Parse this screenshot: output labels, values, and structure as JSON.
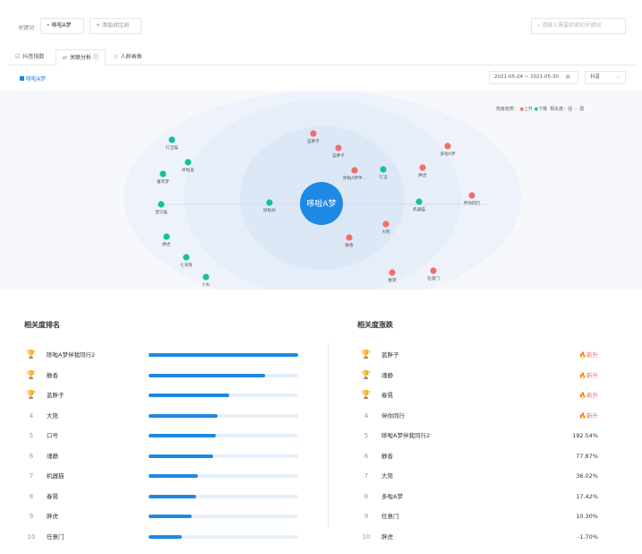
{
  "keyword_bar": {
    "label": "关键词",
    "active_keyword": "哆啦A梦",
    "add_label": "+ 添加对比词",
    "search_placeholder": "请输入需要检索的关键词"
  },
  "tabs": [
    {
      "icon": "☑",
      "label": "抖音指数"
    },
    {
      "icon": "⇄",
      "label": "关联分析 ⓘ"
    },
    {
      "icon": "⛌",
      "label": "人群画像"
    }
  ],
  "filter": {
    "series_label": "哆啦A梦",
    "date_range": "2021-05-24 ~ 2021-05-30",
    "platform": "抖音",
    "calendar_icon": "calendar-icon",
    "accent": "#1e88e5"
  },
  "graph": {
    "center": "哆啦A梦",
    "legend_trend": "热度趋势：",
    "legend_up": "上升",
    "legend_down": "下降",
    "legend_rel": "相关度：强",
    "legend_weak": "弱",
    "up_color": "#f56c6c",
    "down_color": "#12c29d",
    "nodes": [
      {
        "label": "叮当猫",
        "trend": "down"
      },
      {
        "label": "哆啦美",
        "trend": "down"
      },
      {
        "label": "蓝胖子",
        "trend": "up"
      },
      {
        "label": "蓝胖子",
        "trend": "up"
      },
      {
        "label": "多啦A梦",
        "trend": "up"
      },
      {
        "label": "叮当",
        "trend": "down"
      },
      {
        "label": "胖虎",
        "trend": "up"
      },
      {
        "label": "哆啦A梦伴...",
        "trend": "up"
      },
      {
        "label": "童年梦",
        "trend": "down"
      },
      {
        "label": "机器猫",
        "trend": "down"
      },
      {
        "label": "伴你同行",
        "trend": "up"
      },
      {
        "label": "宝贝猫",
        "trend": "down"
      },
      {
        "label": "大熊",
        "trend": "up"
      },
      {
        "label": "静香",
        "trend": "up"
      },
      {
        "label": "胖虎",
        "trend": "down"
      },
      {
        "label": "七龙珠",
        "trend": "down"
      },
      {
        "label": "小丸",
        "trend": "down"
      },
      {
        "label": "哆啦抄",
        "trend": "down"
      },
      {
        "label": "春晃",
        "trend": "up"
      },
      {
        "label": "任意门",
        "trend": "up"
      }
    ]
  },
  "relevance_rank": {
    "title": "相关度排名",
    "items": [
      {
        "rank": "1",
        "trophy": "gold",
        "name": "哆啦A梦伴我同行2",
        "score": 1.0
      },
      {
        "rank": "2",
        "trophy": "silver",
        "name": "静香",
        "score": 0.78
      },
      {
        "rank": "3",
        "trophy": "bronze",
        "name": "蓝胖子",
        "score": 0.54
      },
      {
        "rank": "4",
        "trophy": "",
        "name": "大熊",
        "score": 0.46
      },
      {
        "rank": "5",
        "trophy": "",
        "name": "口号",
        "score": 0.45
      },
      {
        "rank": "6",
        "trophy": "",
        "name": "魂静",
        "score": 0.43
      },
      {
        "rank": "7",
        "trophy": "",
        "name": "机器猫",
        "score": 0.33
      },
      {
        "rank": "8",
        "trophy": "",
        "name": "春晃",
        "score": 0.32
      },
      {
        "rank": "9",
        "trophy": "",
        "name": "胖虎",
        "score": 0.29
      },
      {
        "rank": "10",
        "trophy": "",
        "name": "任意门",
        "score": 0.22
      }
    ]
  },
  "relevance_change": {
    "title": "相关度涨跌",
    "items": [
      {
        "rank": "1",
        "trophy": "gold",
        "name": "蓝胖子",
        "change": "🔥新升",
        "is_new": true
      },
      {
        "rank": "2",
        "trophy": "silver",
        "name": "魂静",
        "change": "🔥新升",
        "is_new": true
      },
      {
        "rank": "3",
        "trophy": "bronze",
        "name": "春晃",
        "change": "🔥新升",
        "is_new": true
      },
      {
        "rank": "4",
        "trophy": "",
        "name": "伴你同行",
        "change": "🔥新升",
        "is_new": true
      },
      {
        "rank": "5",
        "trophy": "",
        "name": "哆啦A梦伴我同行2",
        "change": "192.54%",
        "is_new": false
      },
      {
        "rank": "6",
        "trophy": "",
        "name": "静香",
        "change": "77.87%",
        "is_new": false
      },
      {
        "rank": "7",
        "trophy": "",
        "name": "大熊",
        "change": "36.02%",
        "is_new": false
      },
      {
        "rank": "8",
        "trophy": "",
        "name": "多啦A梦",
        "change": "17.42%",
        "is_new": false
      },
      {
        "rank": "9",
        "trophy": "",
        "name": "任意门",
        "change": "10.30%",
        "is_new": false
      },
      {
        "rank": "10",
        "trophy": "",
        "name": "胖虎",
        "change": "-1.70%",
        "is_new": false
      }
    ]
  }
}
